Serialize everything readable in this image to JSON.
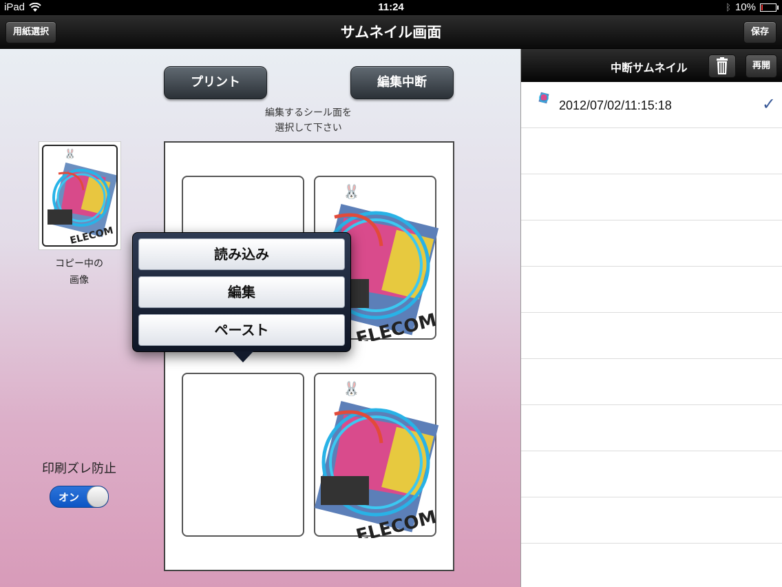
{
  "status_bar": {
    "device": "iPad",
    "time": "11:24",
    "battery": "10%",
    "battery_level": 0.1
  },
  "nav": {
    "left_button": "用紙選択",
    "title": "サムネイル画面",
    "right_button": "保存"
  },
  "main": {
    "print_button": "プリント",
    "suspend_button": "編集中断",
    "instruction_line1": "編集するシール面を",
    "instruction_line2": "選択して下さい",
    "copy_label_line1": "コピー中の",
    "copy_label_line2": "画像",
    "shift_label": "印刷ズレ防止",
    "toggle_label": "オン",
    "artwork_text": "ELECOM"
  },
  "popover": {
    "items": [
      "読み込み",
      "編集",
      "ペースト"
    ]
  },
  "right_panel": {
    "title": "中断サムネイル",
    "resume_button": "再開",
    "trash_icon": "trash-icon",
    "rows": [
      {
        "timestamp": "2012/07/02/11:15:18",
        "check": "✓"
      }
    ]
  },
  "colors": {
    "toggle_on": "#1a63d0",
    "check": "#3a5a98"
  }
}
